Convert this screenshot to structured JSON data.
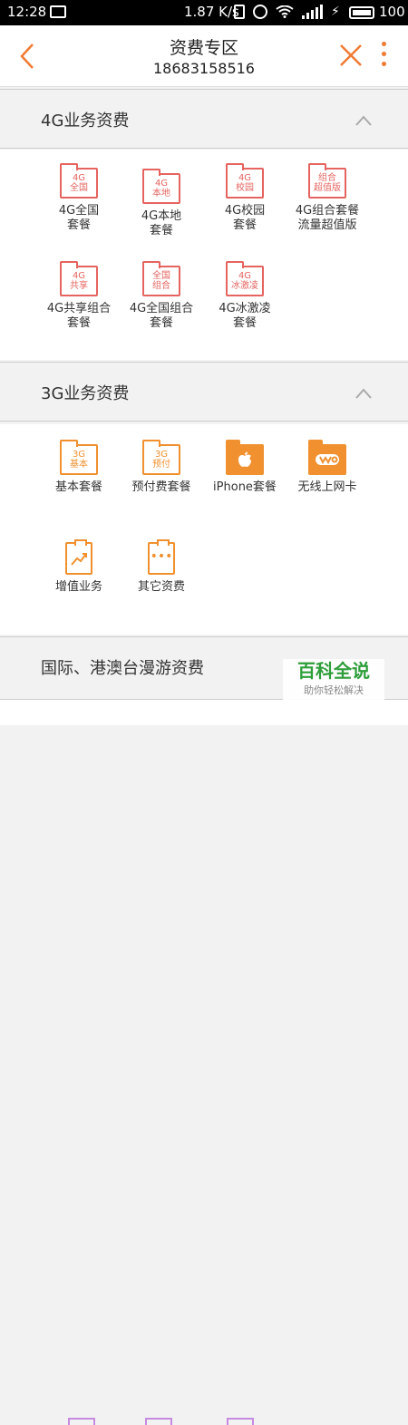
{
  "status": {
    "time": "12:28",
    "speed": "1.87 K/s",
    "battery": "100"
  },
  "header": {
    "title": "资费专区",
    "phone": "18683158516"
  },
  "sections": [
    {
      "title": "4G业务资费",
      "expanded": true,
      "items": [
        {
          "icon_text": "4G\n全国",
          "label": "4G全国\n套餐"
        },
        {
          "icon_text": "4G\n本地",
          "label": "4G本地\n套餐"
        },
        {
          "icon_text": "4G\n校园",
          "label": "4G校园\n套餐"
        },
        {
          "icon_text": "组合\n超值版",
          "label": "4G组合套餐\n流量超值版"
        },
        {
          "icon_text": "4G\n共享",
          "label": "4G共享组合\n套餐"
        },
        {
          "icon_text": "全国\n组合",
          "label": "4G全国组合\n套餐"
        },
        {
          "icon_text": "4G\n冰激凌",
          "label": "4G冰激凌\n套餐"
        }
      ]
    },
    {
      "title": "3G业务资费",
      "expanded": true,
      "items": [
        {
          "icon_text": "3G\n基本",
          "label": "基本套餐"
        },
        {
          "icon_text": "3G\n预付",
          "label": "预付费套餐"
        },
        {
          "icon": "apple-icon",
          "label": "iPhone套餐"
        },
        {
          "icon": "wo-logo-icon",
          "label": "无线上网卡"
        },
        {
          "icon": "chart-clipboard-icon",
          "label": "增值业务"
        },
        {
          "icon": "dots-clipboard-icon",
          "label": "其它资费"
        }
      ]
    },
    {
      "title": "国际、港澳台漫游资费"
    }
  ],
  "watermark": {
    "title": "百科全说",
    "subtitle": "助你轻松解决"
  },
  "colors": {
    "accent": "#f07a32",
    "red_icon": "#e5645f",
    "orange_icon": "#f0902f"
  }
}
